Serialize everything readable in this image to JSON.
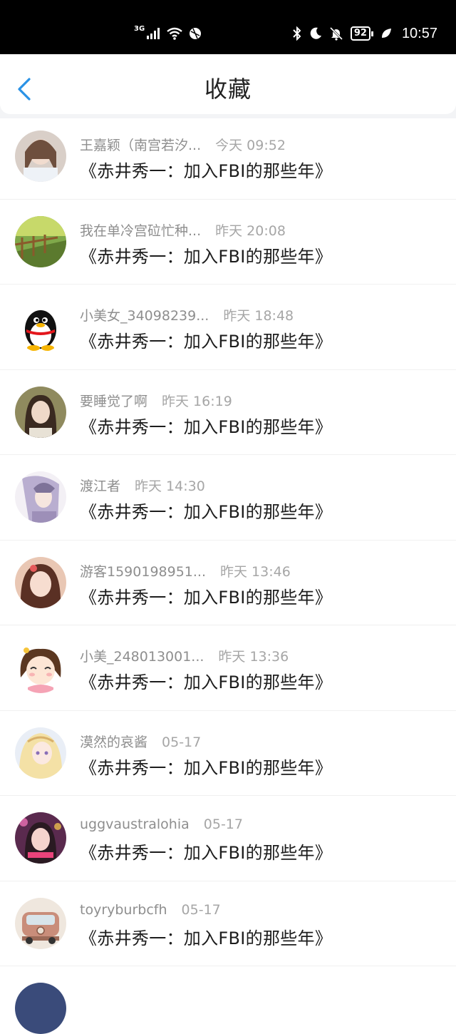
{
  "status_bar": {
    "network": "3G",
    "battery": "92",
    "time": "10:57"
  },
  "header": {
    "title": "收藏"
  },
  "colors": {
    "accent": "#2a92e6",
    "status_bar_bg": "#000000",
    "name_text": "#8e8e8e",
    "book_text": "#1d1d1d"
  },
  "favorites": [
    {
      "user": "王嘉颖（南宫若汐...",
      "time": "今天 09:52",
      "book": "《赤井秀一：加入FBI的那些年》"
    },
    {
      "user": "我在单冷宫砬忙种...",
      "time": "昨天 20:08",
      "book": "《赤井秀一：加入FBI的那些年》"
    },
    {
      "user": "小美女_34098239...",
      "time": "昨天 18:48",
      "book": "《赤井秀一：加入FBI的那些年》"
    },
    {
      "user": "要睡觉了啊",
      "time": "昨天 16:19",
      "book": "《赤井秀一：加入FBI的那些年》"
    },
    {
      "user": "渡江者",
      "time": "昨天 14:30",
      "book": "《赤井秀一：加入FBI的那些年》"
    },
    {
      "user": "游客1590198951...",
      "time": "昨天 13:46",
      "book": "《赤井秀一：加入FBI的那些年》"
    },
    {
      "user": "小美_248013001...",
      "time": "昨天 13:36",
      "book": "《赤井秀一：加入FBI的那些年》"
    },
    {
      "user": "漠然的哀酱",
      "time": "05-17",
      "book": "《赤井秀一：加入FBI的那些年》"
    },
    {
      "user": "uggvaustralohia",
      "time": "05-17",
      "book": "《赤井秀一：加入FBI的那些年》"
    },
    {
      "user": "toyryburbcfh",
      "time": "05-17",
      "book": "《赤井秀一：加入FBI的那些年》"
    }
  ]
}
